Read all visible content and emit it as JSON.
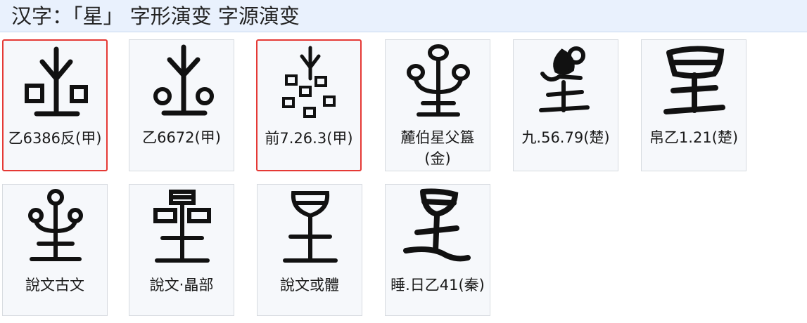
{
  "header": {
    "title": "汉字：「星」 字形演变 字源演变"
  },
  "cards": [
    {
      "label": "乙6386反(甲)",
      "glyph": "oracle-bone-star-1",
      "selected": true
    },
    {
      "label": "乙6672(甲)",
      "glyph": "oracle-bone-star-2",
      "selected": false
    },
    {
      "label": "前7.26.3(甲)",
      "glyph": "oracle-bone-star-3",
      "selected": true
    },
    {
      "label": "麓伯星父簋(金)",
      "glyph": "bronze-star",
      "selected": false
    },
    {
      "label": "九.56.79(楚)",
      "glyph": "chu-bamboo-star",
      "selected": false
    },
    {
      "label": "帛乙1.21(楚)",
      "glyph": "chu-silk-star",
      "selected": false
    },
    {
      "label": "說文古文",
      "glyph": "shuowen-ancient-star",
      "selected": false
    },
    {
      "label": "說文‧晶部",
      "glyph": "shuowen-jing-star",
      "selected": false
    },
    {
      "label": "說文或體",
      "glyph": "shuowen-variant-star",
      "selected": false
    },
    {
      "label": "睡.日乙41(秦)",
      "glyph": "qin-clerical-star",
      "selected": false
    }
  ],
  "colors": {
    "selected_border": "#e53935",
    "header_bg": "#e9f1fd",
    "card_bg": "#f6f8fb"
  }
}
